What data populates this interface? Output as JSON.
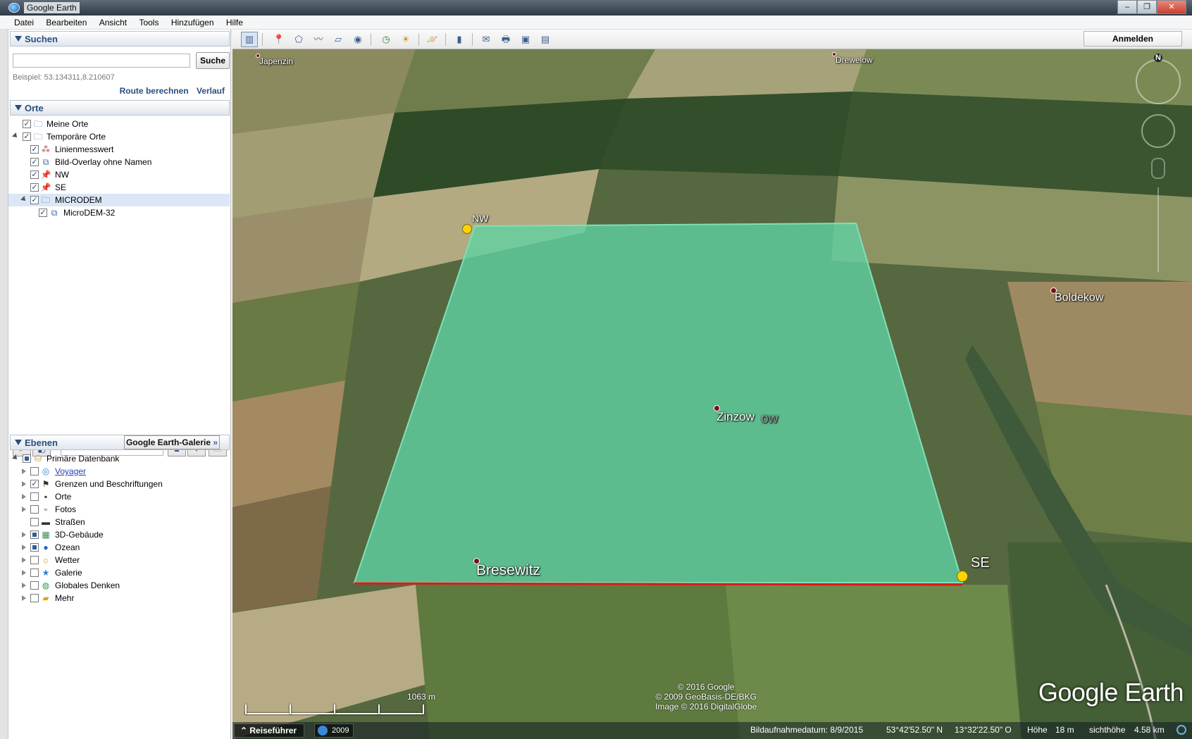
{
  "window": {
    "title": "Google Earth",
    "minimize": "–",
    "maximize": "❐",
    "close": "✕"
  },
  "menu": [
    "Datei",
    "Bearbeiten",
    "Ansicht",
    "Tools",
    "Hinzufügen",
    "Hilfe"
  ],
  "search": {
    "header": "Suchen",
    "input_value": "",
    "button": "Suche",
    "example": "Beispiel: 53.134311,8.210607",
    "route_link": "Route berechnen",
    "history_link": "Verlauf"
  },
  "places": {
    "header": "Orte",
    "items": [
      {
        "label": "Meine Orte",
        "checked": true,
        "icon": "folder-icon",
        "expanded": null
      },
      {
        "label": "Temporäre Orte",
        "checked": true,
        "icon": "folder-icon",
        "expanded": true
      },
      {
        "label": "Linienmesswert",
        "checked": true,
        "icon": "path-icon",
        "expanded": null
      },
      {
        "label": "Bild-Overlay ohne Namen",
        "checked": true,
        "icon": "image-overlay-icon",
        "expanded": null
      },
      {
        "label": "NW",
        "checked": true,
        "icon": "yellow-pushpin-icon",
        "expanded": null
      },
      {
        "label": "SE",
        "checked": true,
        "icon": "yellow-pushpin-icon",
        "expanded": null
      },
      {
        "label": "MICRODEM",
        "checked": true,
        "icon": "folder-icon",
        "expanded": true,
        "selected": true
      },
      {
        "label": "MicroDEM-32",
        "checked": true,
        "icon": "image-overlay-icon",
        "expanded": null
      }
    ]
  },
  "layers": {
    "header": "Ebenen",
    "gallery_button": "Google Earth-Galerie",
    "gallery_chevron": "»",
    "items": [
      {
        "label": "Primäre Datenbank",
        "state": "partial",
        "icon": "database-icon",
        "link": false
      },
      {
        "label": "Voyager",
        "state": "unchecked",
        "icon": "voyager-icon",
        "link": true
      },
      {
        "label": "Grenzen und Beschriftungen",
        "state": "checked",
        "icon": "flag-icon",
        "link": false
      },
      {
        "label": "Orte",
        "state": "unchecked",
        "icon": "places-icon",
        "link": false
      },
      {
        "label": "Fotos",
        "state": "unchecked",
        "icon": "photo-icon",
        "link": false
      },
      {
        "label": "Straßen",
        "state": "unchecked",
        "icon": "road-icon",
        "link": false
      },
      {
        "label": "3D-Gebäude",
        "state": "partial",
        "icon": "building-icon",
        "link": false
      },
      {
        "label": "Ozean",
        "state": "partial",
        "icon": "ocean-icon",
        "link": false
      },
      {
        "label": "Wetter",
        "state": "unchecked",
        "icon": "weather-icon",
        "link": false
      },
      {
        "label": "Galerie",
        "state": "unchecked",
        "icon": "gallery-star-icon",
        "link": false
      },
      {
        "label": "Globales Denken",
        "state": "unchecked",
        "icon": "globe-icon",
        "link": false
      },
      {
        "label": "Mehr",
        "state": "unchecked",
        "icon": "more-icon",
        "link": false
      }
    ]
  },
  "toolbar": {
    "signin": "Anmelden",
    "buttons": [
      {
        "name": "sidebar-toggle-icon",
        "glyph": "▥"
      },
      {
        "name": "add-placemark-icon",
        "glyph": "📍"
      },
      {
        "name": "add-polygon-icon",
        "glyph": "⬠"
      },
      {
        "name": "add-path-icon",
        "glyph": "〰"
      },
      {
        "name": "add-image-overlay-icon",
        "glyph": "▱"
      },
      {
        "name": "record-tour-icon",
        "glyph": "◉"
      },
      {
        "name": "historical-imagery-icon",
        "glyph": "◷"
      },
      {
        "name": "sunlight-icon",
        "glyph": "☀"
      },
      {
        "name": "switch-planet-icon",
        "glyph": "🪐"
      },
      {
        "name": "ruler-icon",
        "glyph": "▮"
      },
      {
        "name": "email-icon",
        "glyph": "✉"
      },
      {
        "name": "print-icon",
        "glyph": "🖶"
      },
      {
        "name": "view-in-maps-icon",
        "glyph": "▣"
      },
      {
        "name": "save-image-icon",
        "glyph": "▤"
      }
    ]
  },
  "map": {
    "labels": {
      "japenzin": "Japenzin",
      "drewelow": "Drewelow",
      "boldekow": "Boldekow",
      "zinzow": "Zinzow",
      "zinzow_ghost": "ow",
      "bresewitz": "Bresewitz",
      "nw": "NW",
      "se": "SE"
    },
    "attribution": [
      "© 2016 Google",
      "© 2009 GeoBasis-DE/BKG",
      "Image © 2016 DigitalGlobe"
    ],
    "logo": "Google Earth",
    "scale_label": "1063  m",
    "compass_n": "N",
    "overlay_color": "#5fd3a4",
    "measure_line_color": "#e01818"
  },
  "status": {
    "tour_button": "Reiseführer",
    "history_year": "2009",
    "imagery_date": "Bildaufnahmedatum: 8/9/2015",
    "lat": "53°42'52.50\" N",
    "lon": "13°32'22.50\" O",
    "elevation_label": "Höhe",
    "elevation_value": "18 m",
    "eye_alt_label": "sichthöhe",
    "eye_alt_value": "4.58 km"
  }
}
